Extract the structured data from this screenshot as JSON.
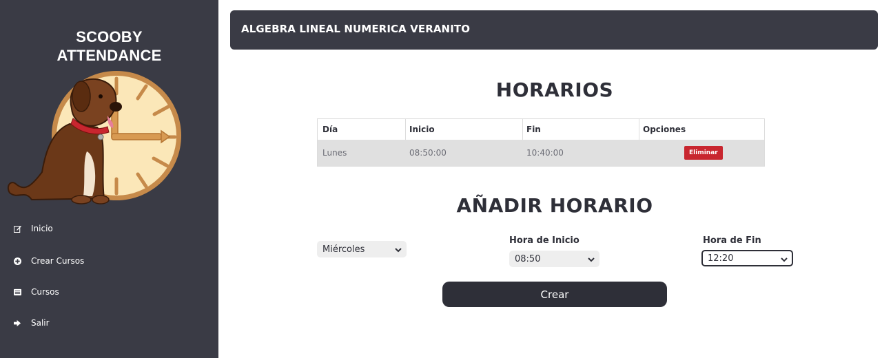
{
  "sidebar": {
    "brand_line1": "SCOOBY",
    "brand_line2": "ATTENDANCE",
    "items": [
      {
        "label": "Inicio",
        "icon": "edit-icon"
      },
      {
        "label": "Crear Cursos",
        "icon": "plus-circle-icon"
      },
      {
        "label": "Cursos",
        "icon": "list-icon"
      },
      {
        "label": "Salir",
        "icon": "sign-out-icon"
      }
    ]
  },
  "header": {
    "title": "ALGEBRA LINEAL NUMERICA VERANITO"
  },
  "schedule": {
    "heading": "HORARIOS",
    "columns": [
      "Día",
      "Inicio",
      "Fin",
      "Opciones"
    ],
    "rows": [
      {
        "dia": "Lunes",
        "inicio": "08:50:00",
        "fin": "10:40:00",
        "action": "Eliminar"
      }
    ]
  },
  "form": {
    "heading": "AÑADIR HORARIO",
    "day_value": "Miércoles",
    "start_label": "Hora de Inicio",
    "start_value": "08:50",
    "end_label": "Hora de Fin",
    "end_value": "12:20",
    "submit_label": "Crear"
  },
  "colors": {
    "sidebar_bg": "#3a3b45",
    "delete_button": "#c8262f",
    "dark_button": "#2e2f38"
  }
}
